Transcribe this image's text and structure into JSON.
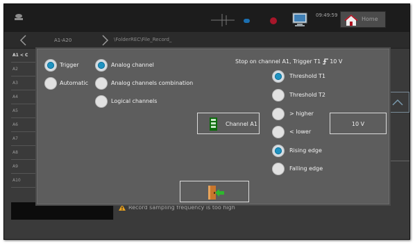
{
  "header": {
    "clock": "09:49:59",
    "home_label": "Home"
  },
  "pathbar": {
    "range": "A1-A20",
    "path": "\\FolderREC\\File_Record_"
  },
  "bg_table": {
    "head": "A1 < C",
    "rows": [
      "A2",
      "A3",
      "A4",
      "A5",
      "A6",
      "A7",
      "A8",
      "A9",
      "A10"
    ]
  },
  "warning": "Record sampling frequency is too high",
  "modal": {
    "trigger_label": "Trigger",
    "automatic_label": "Automatic",
    "analog_channel_label": "Analog channel",
    "analog_combination_label": "Analog channels combination",
    "logical_channels_label": "Logical channels",
    "status_prefix": "Stop on channel A1, Trigger T1",
    "status_value": "10 V",
    "threshold_t1_label": "Threshold T1",
    "threshold_t2_label": "Threshold T2",
    "higher_label": "> higher",
    "lower_label": "< lower",
    "rising_edge_label": "Rising edge",
    "falling_edge_label": "Falling edge",
    "channel_button_label": "Channel A1",
    "value_button_label": "10 V",
    "selected": {
      "mode": "Trigger",
      "source": "Analog channel",
      "threshold": "Threshold T1",
      "edge": "Rising edge"
    }
  },
  "colors": {
    "accent": "#1f93c2",
    "record": "#a7162a",
    "chip": "#0d6b0d",
    "exit_arrow": "#2eb82e"
  },
  "icons": {
    "logo": "logo-icon",
    "scope": "scope-icon",
    "record": "record-icon",
    "pc": "pc-icon",
    "home": "home-icon",
    "back": "chevron-left-icon",
    "forward": "chevron-right-icon",
    "warning": "warning-icon",
    "edge": "rising-edge-icon",
    "chip": "chip-icon",
    "exit": "exit-icon"
  }
}
